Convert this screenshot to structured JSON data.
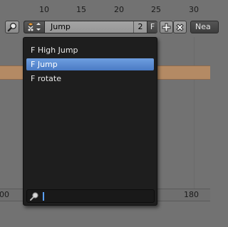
{
  "ruler": {
    "ticks": [
      "10",
      "15",
      "20",
      "25",
      "30"
    ]
  },
  "bottom_ruler": {
    "left_label": "00",
    "right_label": "180"
  },
  "toolbar": {
    "search_icon": "magnifier-icon",
    "action_type_icon": "action-icon",
    "action_name": "Jump",
    "users_count": "2",
    "fake_user_label": "F",
    "new_icon": "plus-icon",
    "unlink_icon": "x-icon",
    "near_label": "Nea"
  },
  "popup": {
    "items": [
      {
        "label": "F High Jump",
        "active": false
      },
      {
        "label": "F Jump",
        "active": true
      },
      {
        "label": "F rotate",
        "active": false
      }
    ],
    "search": {
      "value": "",
      "placeholder": ""
    }
  },
  "colors": {
    "highlight": "#5a8ad3",
    "popup_bg": "#1e1e1e",
    "strip_orange": "#b48a64"
  }
}
